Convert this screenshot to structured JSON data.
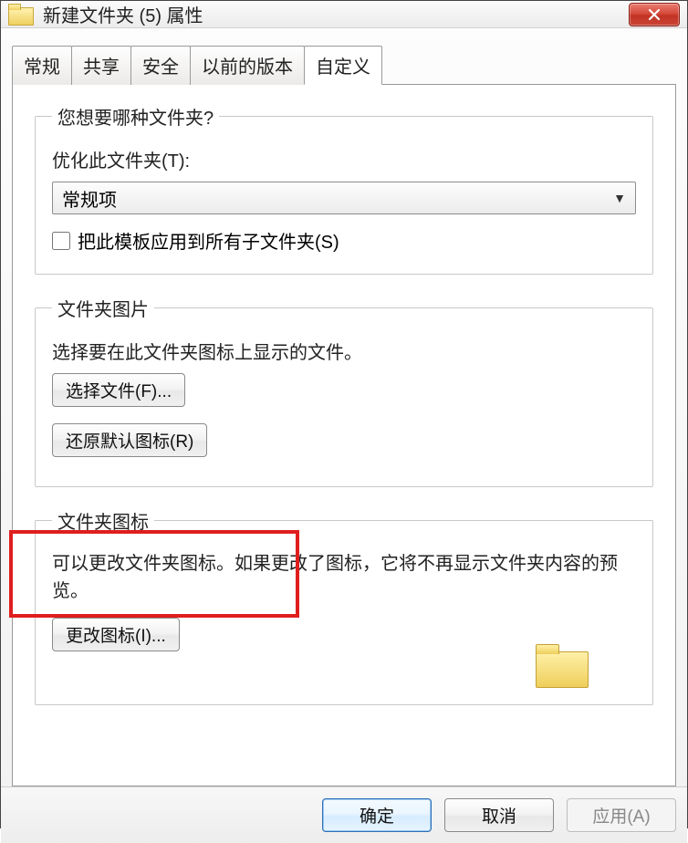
{
  "window": {
    "title": "新建文件夹 (5) 属性"
  },
  "tabs": [
    {
      "label": "常规"
    },
    {
      "label": "共享"
    },
    {
      "label": "安全"
    },
    {
      "label": "以前的版本"
    },
    {
      "label": "自定义"
    }
  ],
  "group1": {
    "legend": "您想要哪种文件夹?",
    "optimize_label": "优化此文件夹(T):",
    "dropdown_value": "常规项",
    "checkbox_label": "把此模板应用到所有子文件夹(S)"
  },
  "group2": {
    "legend": "文件夹图片",
    "desc": "选择要在此文件夹图标上显示的文件。",
    "choose_btn": "选择文件(F)...",
    "restore_btn": "还原默认图标(R)"
  },
  "group3": {
    "legend": "文件夹图标",
    "desc": "可以更改文件夹图标。如果更改了图标，它将不再显示文件夹内容的预览。",
    "change_btn": "更改图标(I)..."
  },
  "buttons": {
    "ok": "确定",
    "cancel": "取消",
    "apply": "应用(A)"
  }
}
